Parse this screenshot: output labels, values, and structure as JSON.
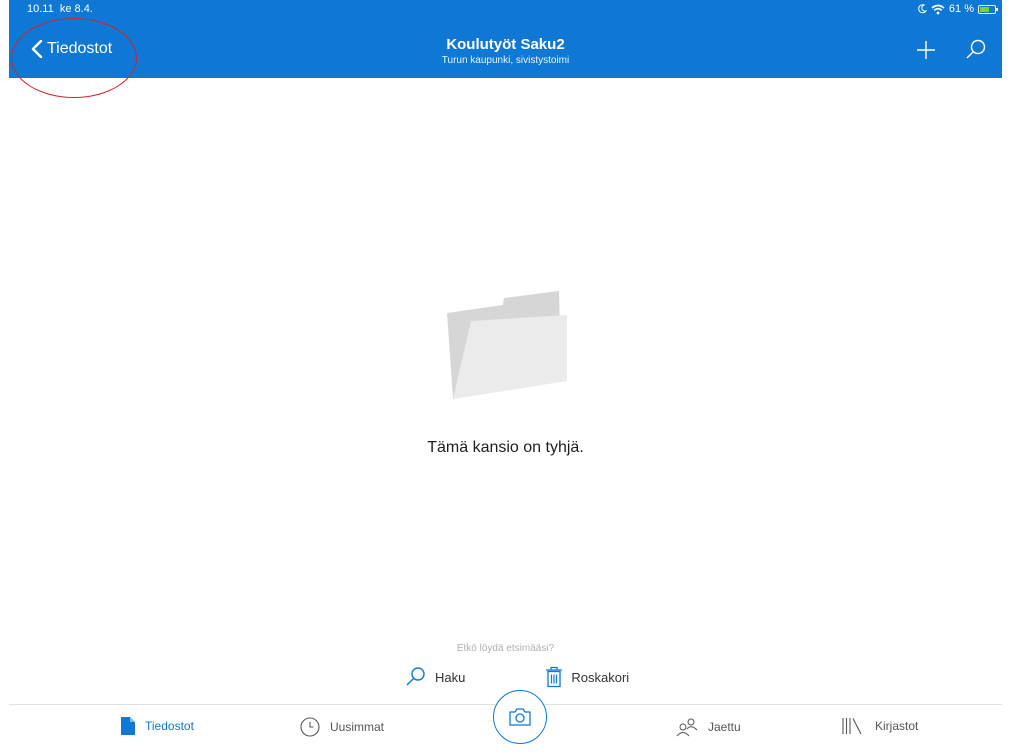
{
  "status_bar": {
    "time": "10.11",
    "date": "ke 8.4.",
    "battery": "61 %",
    "battery_level_percent": 61
  },
  "nav": {
    "back_label": "Tiedostot",
    "title": "Koulutyöt Saku2",
    "subtitle": "Turun kaupunki, sivistystoimi",
    "add_icon": "plus-icon",
    "search_icon": "search-icon"
  },
  "empty_state": {
    "icon": "folder-icon",
    "message": "Tämä kansio on tyhjä."
  },
  "hint": {
    "text": "Etkö löydä etsimääsi?",
    "actions": [
      {
        "label": "Haku",
        "icon": "search-icon"
      },
      {
        "label": "Roskakori",
        "icon": "trash-icon"
      }
    ]
  },
  "tabs": [
    {
      "label": "Tiedostot",
      "icon": "file-icon",
      "active": true
    },
    {
      "label": "Uusimmat",
      "icon": "clock-icon",
      "active": false
    },
    {
      "label": "Jaettu",
      "icon": "people-icon",
      "active": false
    },
    {
      "label": "Kirjastot",
      "icon": "library-icon",
      "active": false
    }
  ],
  "camera_icon": "camera-icon",
  "colors": {
    "brand": "#0f78d4",
    "annotation": "#d3222a",
    "battery": "#7ed321"
  }
}
